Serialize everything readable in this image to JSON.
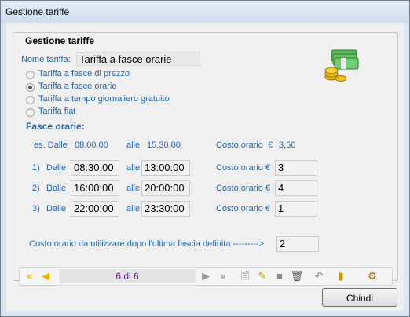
{
  "window": {
    "title": "Gestione tariffe"
  },
  "group": {
    "title": "Gestione tariffe"
  },
  "tariff": {
    "name_label": "Nome tariffa:",
    "name_value": "Tariffa a fasce orarie"
  },
  "options": [
    {
      "label": "Tariffa a fasce di prezzo",
      "checked": false
    },
    {
      "label": "Tariffa a fasce orarie",
      "checked": true
    },
    {
      "label": "Tariffa a tempo giornaliero gratuito",
      "checked": false
    },
    {
      "label": "Tariffa flat",
      "checked": false
    }
  ],
  "bands": {
    "title": "Fasce orarie:",
    "example": {
      "prefix": "es. Dalle",
      "from": "08.00.00",
      "to_label": "alle",
      "to": "15.30.00",
      "cost_label": "Costo orario",
      "currency": "€",
      "cost": "3,50"
    },
    "rows": [
      {
        "num": "1)",
        "from_label": "Dalle",
        "from": "08:30:00",
        "to_label": "alle",
        "to": "13:00:00",
        "cost_label": "Costo orario",
        "currency": "€",
        "cost": "3"
      },
      {
        "num": "2)",
        "from_label": "Dalle",
        "from": "16:00:00",
        "to_label": "alle",
        "to": "20:00:00",
        "cost_label": "Costo orario",
        "currency": "€",
        "cost": "4"
      },
      {
        "num": "3)",
        "from_label": "Dalle",
        "from": "22:00:00",
        "to_label": "alle",
        "to": "23:30:00",
        "cost_label": "Costo orario",
        "currency": "€",
        "cost": "1"
      }
    ],
    "after": {
      "label": "Costo orario da utilizzare dopo l'ultima fascia definita --------->",
      "value": "2"
    }
  },
  "navigator": {
    "position": "6 di 6"
  },
  "buttons": {
    "close": "Chiudi"
  },
  "colors": {
    "label_blue": "#1f66b5",
    "nav_arrow": "#f0b400",
    "pager_text": "#6b1a8a"
  }
}
